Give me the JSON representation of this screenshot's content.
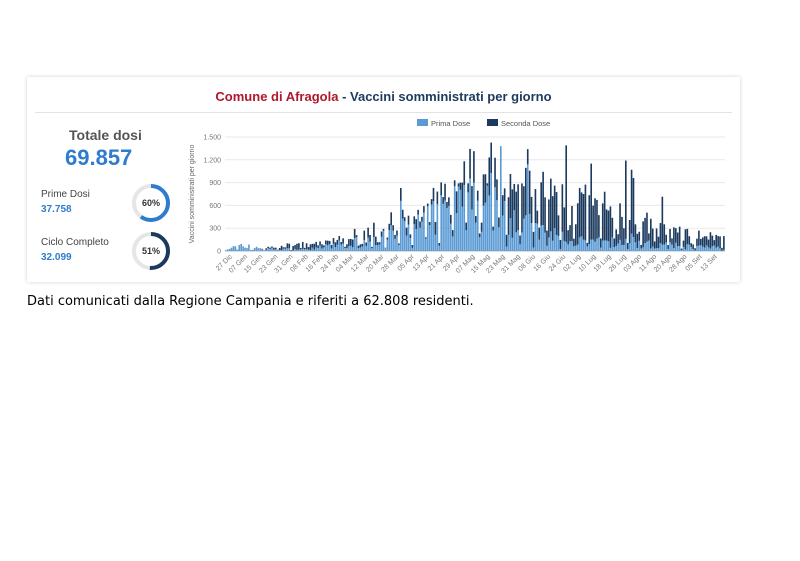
{
  "header": {
    "place": "Comune di Afragola",
    "separator": " - ",
    "subtitle": "Vaccini somministrati per giorno"
  },
  "summary": {
    "total_label": "Totale dosi",
    "total_value": "69.857",
    "first": {
      "label": "Prime Dosi",
      "value": "37.758",
      "percent": 60,
      "percent_label": "60%",
      "color": "#2f7ccf"
    },
    "complete": {
      "label": "Ciclo Completo",
      "value": "32.099",
      "percent": 51,
      "percent_label": "51%",
      "color": "#1c3a5e"
    }
  },
  "footnote": "Dati comunicati dalla Regione Campania e riferiti a 62.808 residenti.",
  "colors": {
    "prima": "#5b9bd5",
    "seconda": "#1c3a5e",
    "ring_track": "#e6e6e6"
  },
  "chart_data": {
    "type": "bar",
    "stacked": true,
    "ylabel": "Vaccini somministrati per giorno",
    "ylim": [
      0,
      1500
    ],
    "yticks": [
      0,
      300,
      600,
      900,
      1200,
      1500
    ],
    "ytick_labels": [
      "0",
      "300",
      "600",
      "900",
      "1.200",
      "1.500"
    ],
    "xtick_labels": [
      "27 Dic",
      "07 Gen",
      "15 Gen",
      "23 Gen",
      "31 Gen",
      "08 Feb",
      "16 Feb",
      "24 Feb",
      "04 Mar",
      "12 Mar",
      "20 Mar",
      "28 Mar",
      "05 Apr",
      "13 Apr",
      "21 Apr",
      "29 Apr",
      "07 Mag",
      "15 Mag",
      "23 Mag",
      "31 Mag",
      "08 Giu",
      "16 Giu",
      "24 Giu",
      "02 Lug",
      "10 Lug",
      "18 Lug",
      "26 Lug",
      "03 Ago",
      "11 Ago",
      "20 Ago",
      "28 Ago",
      "05 Set",
      "13 Set"
    ],
    "legend_position": "top-center",
    "series": [
      {
        "name": "Prima Dose",
        "color": "#5b9bd5"
      },
      {
        "name": "Seconda Dose",
        "color": "#1c3a5e"
      }
    ],
    "anchors": {
      "prima": [
        [
          0,
          30
        ],
        [
          8,
          60
        ],
        [
          14,
          40
        ],
        [
          21,
          25
        ],
        [
          28,
          30
        ],
        [
          35,
          20
        ],
        [
          42,
          25
        ],
        [
          49,
          45
        ],
        [
          56,
          80
        ],
        [
          63,
          100
        ],
        [
          70,
          120
        ],
        [
          77,
          140
        ],
        [
          84,
          170
        ],
        [
          91,
          220
        ],
        [
          98,
          300
        ],
        [
          105,
          380
        ],
        [
          112,
          460
        ],
        [
          119,
          560
        ],
        [
          126,
          600
        ],
        [
          133,
          620
        ],
        [
          140,
          650
        ],
        [
          147,
          520
        ],
        [
          154,
          360
        ],
        [
          161,
          260
        ],
        [
          168,
          210
        ],
        [
          175,
          170
        ],
        [
          182,
          140
        ],
        [
          189,
          120
        ],
        [
          196,
          110
        ],
        [
          203,
          110
        ],
        [
          210,
          100
        ],
        [
          217,
          90
        ],
        [
          224,
          80
        ],
        [
          231,
          70
        ],
        [
          238,
          60
        ],
        [
          245,
          55
        ],
        [
          252,
          50
        ],
        [
          259,
          45
        ]
      ],
      "seconda": [
        [
          0,
          0
        ],
        [
          8,
          0
        ],
        [
          14,
          0
        ],
        [
          20,
          10
        ],
        [
          28,
          30
        ],
        [
          35,
          50
        ],
        [
          42,
          60
        ],
        [
          49,
          40
        ],
        [
          56,
          50
        ],
        [
          63,
          70
        ],
        [
          70,
          80
        ],
        [
          77,
          70
        ],
        [
          84,
          60
        ],
        [
          91,
          60
        ],
        [
          98,
          80
        ],
        [
          105,
          120
        ],
        [
          112,
          160
        ],
        [
          119,
          200
        ],
        [
          126,
          230
        ],
        [
          133,
          280
        ],
        [
          140,
          320
        ],
        [
          147,
          360
        ],
        [
          154,
          420
        ],
        [
          161,
          470
        ],
        [
          168,
          500
        ],
        [
          175,
          520
        ],
        [
          182,
          480
        ],
        [
          189,
          430
        ],
        [
          196,
          390
        ],
        [
          203,
          340
        ],
        [
          210,
          290
        ],
        [
          217,
          250
        ],
        [
          224,
          220
        ],
        [
          231,
          190
        ],
        [
          238,
          170
        ],
        [
          245,
          150
        ],
        [
          252,
          130
        ],
        [
          259,
          110
        ]
      ]
    },
    "day_count": 260,
    "peaks": [
      {
        "day": 143,
        "prima": 1380,
        "seconda": 0
      },
      {
        "day": 177,
        "prima": 120,
        "seconda": 1270
      },
      {
        "day": 136,
        "prima": 860,
        "seconda": 30
      },
      {
        "day": 157,
        "prima": 1140,
        "seconda": 200
      },
      {
        "day": 190,
        "prima": 150,
        "seconda": 1000
      },
      {
        "day": 121,
        "prima": 850,
        "seconda": 40
      },
      {
        "day": 208,
        "prima": 160,
        "seconda": 1030
      },
      {
        "day": 113,
        "prima": 620,
        "seconda": 90
      }
    ]
  }
}
